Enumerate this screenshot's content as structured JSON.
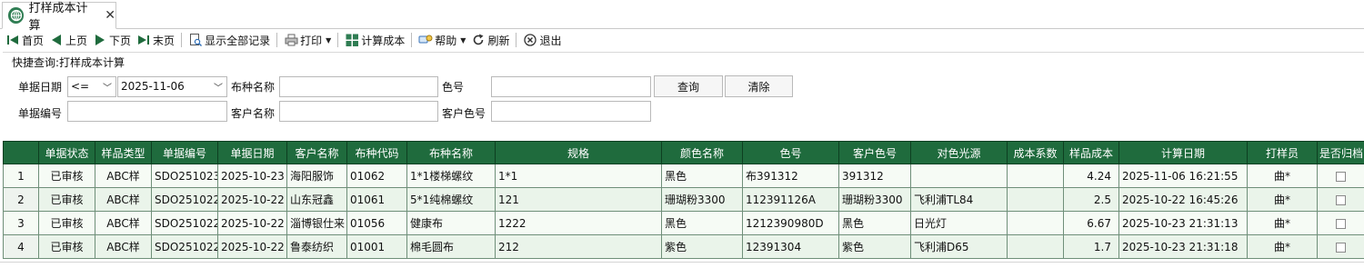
{
  "tab": {
    "title": "打样成本计算",
    "close": "✕",
    "icon": "globe-icon"
  },
  "toolbar": {
    "first": "首页",
    "prev": "上页",
    "next": "下页",
    "last": "末页",
    "show_all": "显示全部记录",
    "print": "打印",
    "calc_cost": "计算成本",
    "help": "帮助",
    "refresh": "刷新",
    "exit": "退出"
  },
  "query": {
    "title": "快捷查询:打样成本计算",
    "doc_date_label": "单据日期",
    "operator": "<=",
    "date_value": "2025-11-06",
    "fabric_name_label": "布种名称",
    "fabric_name_value": "",
    "color_no_label": "色号",
    "color_no_value": "",
    "query_button": "查询",
    "clear_button": "清除",
    "doc_no_label": "单据编号",
    "doc_no_value": "",
    "customer_name_label": "客户名称",
    "customer_name_value": "",
    "customer_color_label": "客户色号",
    "customer_color_value": ""
  },
  "grid": {
    "headers": [
      "",
      "单据状态",
      "样品类型",
      "单据编号",
      "单据日期",
      "客户名称",
      "布种代码",
      "布种名称",
      "规格",
      "颜色名称",
      "色号",
      "客户色号",
      "对色光源",
      "成本系数",
      "样品成本",
      "计算日期",
      "打样员",
      "是否归档"
    ],
    "rows": [
      [
        "1",
        "已审核",
        "ABC样",
        "SDO251023",
        "2025-10-23",
        "海阳服饰",
        "01062",
        "1*1楼梯螺纹",
        "1*1",
        "黑色",
        "布391312",
        "391312",
        "",
        "",
        "4.24",
        "2025-11-06 16:21:55",
        "曲*",
        ""
      ],
      [
        "2",
        "已审核",
        "ABC样",
        "SDO251022",
        "2025-10-22",
        "山东冠鑫",
        "01061",
        "5*1纯棉螺纹",
        "121",
        "珊瑚粉3300",
        "112391126A",
        "珊瑚粉3300",
        "飞利浦TL84",
        "",
        "2.5",
        "2025-10-22 16:45:26",
        "曲*",
        ""
      ],
      [
        "3",
        "已审核",
        "ABC样",
        "SDO251022",
        "2025-10-22",
        "淄博银仕来",
        "01056",
        "健康布",
        "1222",
        "黑色",
        "1212390980D",
        "黑色",
        "日光灯",
        "",
        "6.67",
        "2025-10-23 21:31:13",
        "曲*",
        ""
      ],
      [
        "4",
        "已审核",
        "ABC样",
        "SDO251022",
        "2025-10-22",
        "鲁泰纺织",
        "01001",
        "棉毛圆布",
        "212",
        "紫色",
        "12391304",
        "紫色",
        "飞利浦D65",
        "",
        "1.7",
        "2025-10-23 21:31:18",
        "曲*",
        ""
      ]
    ]
  },
  "colors": {
    "header_bg": "#1f6b3d",
    "row_bg": "#eaf4ea",
    "accent": "#2f7d53"
  }
}
